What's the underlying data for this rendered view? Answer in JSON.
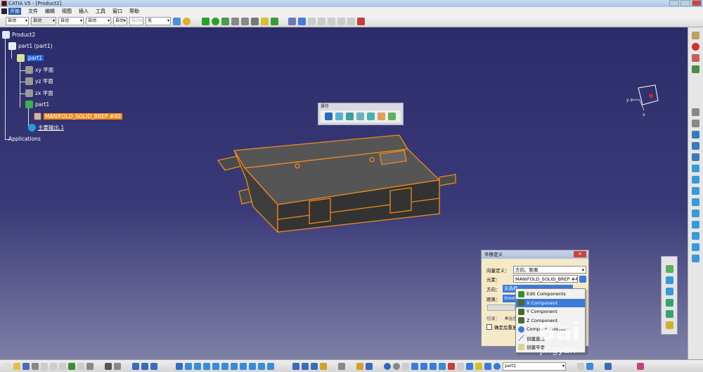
{
  "window": {
    "title": "CATIA V5 - [Product2]"
  },
  "menu": [
    "开始",
    "文件",
    "编辑",
    "视图",
    "插入",
    "工具",
    "窗口",
    "帮助"
  ],
  "toolbar": {
    "selects": [
      "自动",
      "自动",
      "自动",
      "自动",
      "自动",
      "自动",
      "无"
    ]
  },
  "tree": {
    "root": "Product2",
    "part_instance": "part1 (part1)",
    "part": "part1",
    "planes": [
      "xy 平面",
      "yz 平面",
      "zx 平面"
    ],
    "body": "part1",
    "solid": "MANIFOLD_SOLID_BREP #40",
    "output": "主要输出.1",
    "applications": "Applications"
  },
  "operations_toolbar": {
    "title": "操作"
  },
  "dialog": {
    "title": "平移定义",
    "vector_label": "向量定义：",
    "vector_value": "方向、距离",
    "element_label": "元素：",
    "element_value": "MANIFOLD_SOLID_BREP #40",
    "direction_label": "方向：",
    "direction_value": "无选择",
    "distance_label": "距离：",
    "distance_value": "0mm",
    "result_label": "结果：",
    "result_option": "曲面",
    "repeat_label": "确定后重复对象"
  },
  "context_menu": [
    "Edit Components",
    "X Component",
    "Y Component",
    "Z Component",
    "Compute Direction",
    "创建直线",
    "创建平面"
  ],
  "context_menu_active": "X Component",
  "status": {
    "current_part": "part1"
  },
  "watermark": {
    "text": "Baidu",
    "sub": "jingyan"
  },
  "colors": {
    "selection": "#f28a1b",
    "highlight": "#1b63d6",
    "viewport_top": "#2c2c6a",
    "viewport_bottom": "#7f80a6"
  }
}
